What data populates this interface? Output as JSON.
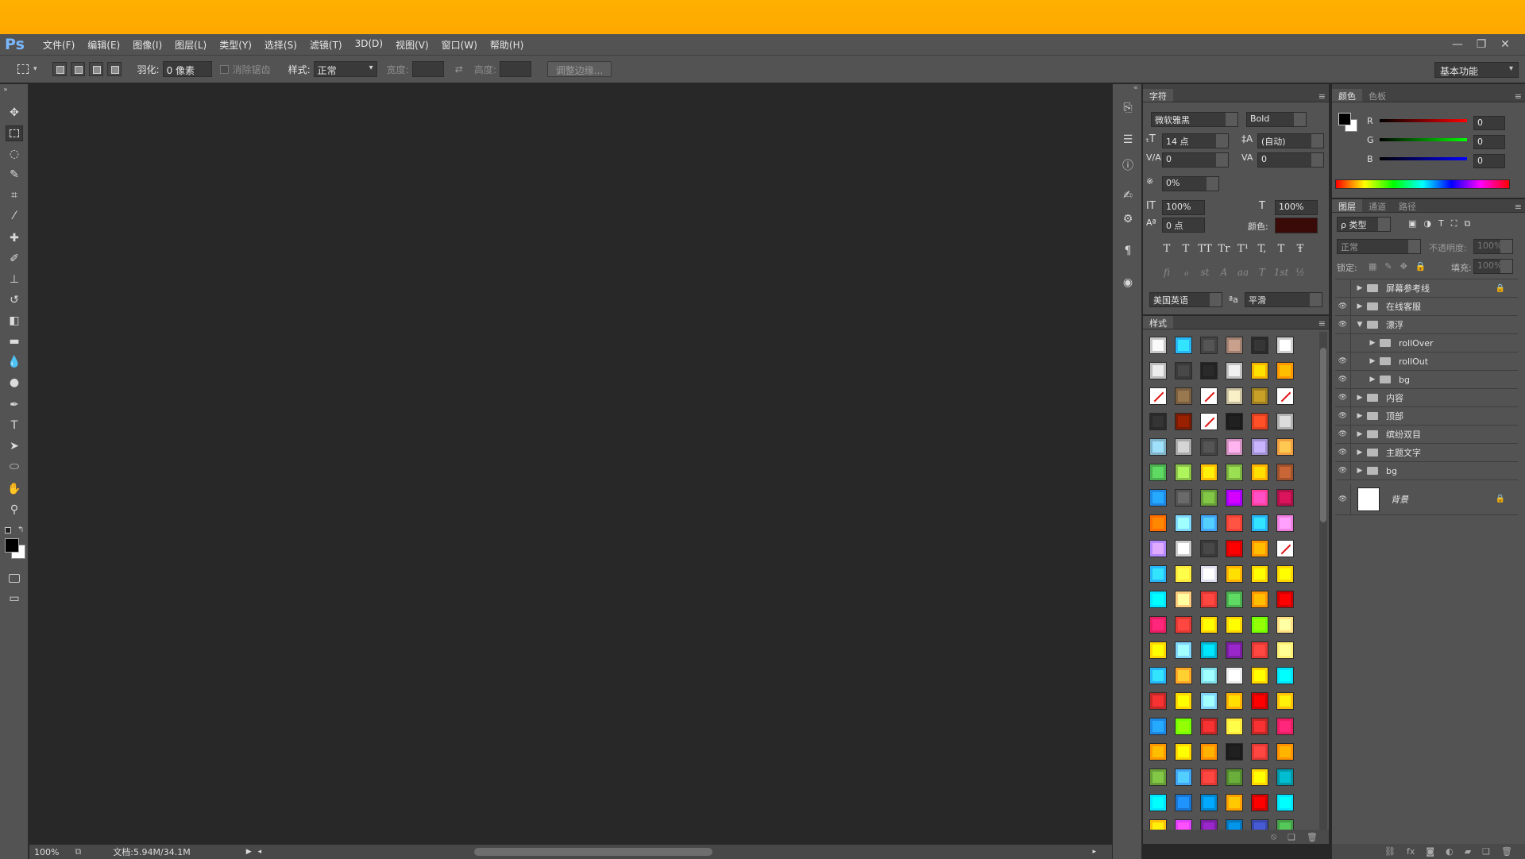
{
  "app": {
    "logo": "Ps"
  },
  "menu": [
    "文件(F)",
    "编辑(E)",
    "图像(I)",
    "图层(L)",
    "类型(Y)",
    "选择(S)",
    "滤镜(T)",
    "3D(D)",
    "视图(V)",
    "窗口(W)",
    "帮助(H)"
  ],
  "window_controls": {
    "minimize": "—",
    "restore": "❐",
    "close": "✕"
  },
  "options": {
    "feather_label": "羽化:",
    "feather_value": "0 像素",
    "antialias_label": "消除锯齿",
    "style_label": "样式:",
    "style_value": "正常",
    "width_label": "宽度:",
    "height_label": "高度:",
    "refine_edge": "调整边缘...",
    "workspace": "基本功能"
  },
  "status": {
    "zoom": "100%",
    "doc": "文档:5.94M/34.1M"
  },
  "character": {
    "tab_char": "字符",
    "font": "微软雅黑",
    "weight": "Bold",
    "size": "14 点",
    "leading": "(自动)",
    "kerning": "0",
    "tracking": "0",
    "tsume": "0%",
    "vscale": "100%",
    "hscale": "100%",
    "baseline": "0 点",
    "color_label": "颜色:",
    "color_value": "#3a0a08",
    "type_style_buttons": [
      "T",
      "T",
      "TT",
      "Tr",
      "T¹",
      "T,",
      "T",
      "Ŧ"
    ],
    "opentype_buttons": [
      "fi",
      "ℴ",
      "st",
      "A",
      "aa",
      "T",
      "1st",
      "½"
    ],
    "language": "美国英语",
    "aa_label": "ªa",
    "aa_value": "平滑"
  },
  "styles": {
    "tab": "样式",
    "swatches": [
      [
        "#c8c8c8",
        "#29b6f6",
        "#444444",
        "#a08070",
        "#2b2b2b",
        "#d0d0d0"
      ],
      [
        "#bdbdbd",
        "#3a3a3a",
        "#222222",
        "#c0c0c0",
        "#f4b400",
        "#ff9800"
      ],
      [
        "none",
        "#7a6040",
        "none",
        "#c8c0a0",
        "#a08020",
        "none"
      ],
      [
        "#2a2a2a",
        "#7a1a00",
        "none",
        "#1a1a1a",
        "#e04020",
        "#b0b0b0"
      ],
      [
        "#7fb3c8",
        "#aaaaaa",
        "#444444",
        "#d090c0",
        "#a090d0",
        "#f0a040"
      ],
      [
        "#4caf50",
        "#8bc34a",
        "#ffc107",
        "#7cb342",
        "#ffb300",
        "#a0522d"
      ],
      [
        "#1e88e5",
        "#555555",
        "#689f38",
        "#aa00ff",
        "#ff40a0",
        "#b0104a"
      ],
      [
        "#ff6d00",
        "#80d8ff",
        "#42a5f5",
        "#f44336",
        "#29b6f6",
        "#f080e0"
      ],
      [
        "#b388ff",
        "#cccccc",
        "#3a3a3a",
        "#e00000",
        "#ff9800",
        "none"
      ],
      [
        "#29b6f6",
        "#ffeb3b",
        "#e0e0f0",
        "#ffb300",
        "#ffd600",
        "#ffd600"
      ],
      [
        "#00e5ff",
        "#ffcc80",
        "#e53935",
        "#4caf50",
        "#ff9800",
        "#d50000"
      ],
      [
        "#e91e63",
        "#e53935",
        "#ffd600",
        "#ffd600",
        "#76ff03",
        "#ffe082"
      ],
      [
        "#ffd600",
        "#81d4fa",
        "#00b8d4",
        "#7b1fa2",
        "#e53935",
        "#fff176"
      ],
      [
        "#29b6f6",
        "#ffa726",
        "#80deea",
        "#eeeeee",
        "#ffd600",
        "#00e5ff"
      ],
      [
        "#c62828",
        "#ffd600",
        "#81d4fa",
        "#ffb300",
        "#d50000",
        "#ffc107"
      ],
      [
        "#1e88e5",
        "#76ff03",
        "#c62828",
        "#ffeb3b",
        "#c62828",
        "#e91e63"
      ],
      [
        "#ff9800",
        "#ffd600",
        "#ff8f00",
        "#1a1a1a",
        "#e53935",
        "#ff9100"
      ],
      [
        "#689f38",
        "#42a5f5",
        "#e53935",
        "#558b2f",
        "#ffd600",
        "#0097a7"
      ],
      [
        "#00e5ff",
        "#1976d2",
        "#0288d1",
        "#ffa000",
        "#d50000",
        "#00e5ff"
      ],
      [
        "#ffc107",
        "#e040fb",
        "#7b1fa2",
        "#0277bd",
        "#3949ab",
        "#43a047"
      ]
    ]
  },
  "color": {
    "tab_color": "颜色",
    "tab_swatches": "色板",
    "r_label": "R",
    "g_label": "G",
    "b_label": "B",
    "r": "0",
    "g": "0",
    "b": "0"
  },
  "layers": {
    "tab_layers": "图层",
    "tab_channels": "通道",
    "tab_paths": "路径",
    "filter": "ρ 类型",
    "blend": "正常",
    "opacity_label": "不透明度:",
    "opacity": "100%",
    "lock_label": "锁定:",
    "fill_label": "填充:",
    "fill": "100%",
    "items": [
      {
        "name": "屏幕参考线",
        "indent": 0,
        "open": false,
        "visible": false,
        "locked": true
      },
      {
        "name": "在线客服",
        "indent": 0,
        "open": false,
        "visible": true,
        "locked": false
      },
      {
        "name": "漂浮",
        "indent": 0,
        "open": true,
        "visible": true,
        "locked": false
      },
      {
        "name": "rollOver",
        "indent": 1,
        "open": false,
        "visible": false,
        "locked": false
      },
      {
        "name": "rollOut",
        "indent": 1,
        "open": false,
        "visible": true,
        "locked": false
      },
      {
        "name": "bg",
        "indent": 1,
        "open": false,
        "visible": true,
        "locked": false
      },
      {
        "name": "内容",
        "indent": 0,
        "open": false,
        "visible": true,
        "locked": false
      },
      {
        "name": "顶部",
        "indent": 0,
        "open": false,
        "visible": true,
        "locked": false
      },
      {
        "name": "缤纷双目",
        "indent": 0,
        "open": false,
        "visible": true,
        "locked": false
      },
      {
        "name": "主题文字",
        "indent": 0,
        "open": false,
        "visible": true,
        "locked": false
      },
      {
        "name": "bg",
        "indent": 0,
        "open": false,
        "visible": true,
        "locked": false
      }
    ],
    "background": "背景"
  }
}
